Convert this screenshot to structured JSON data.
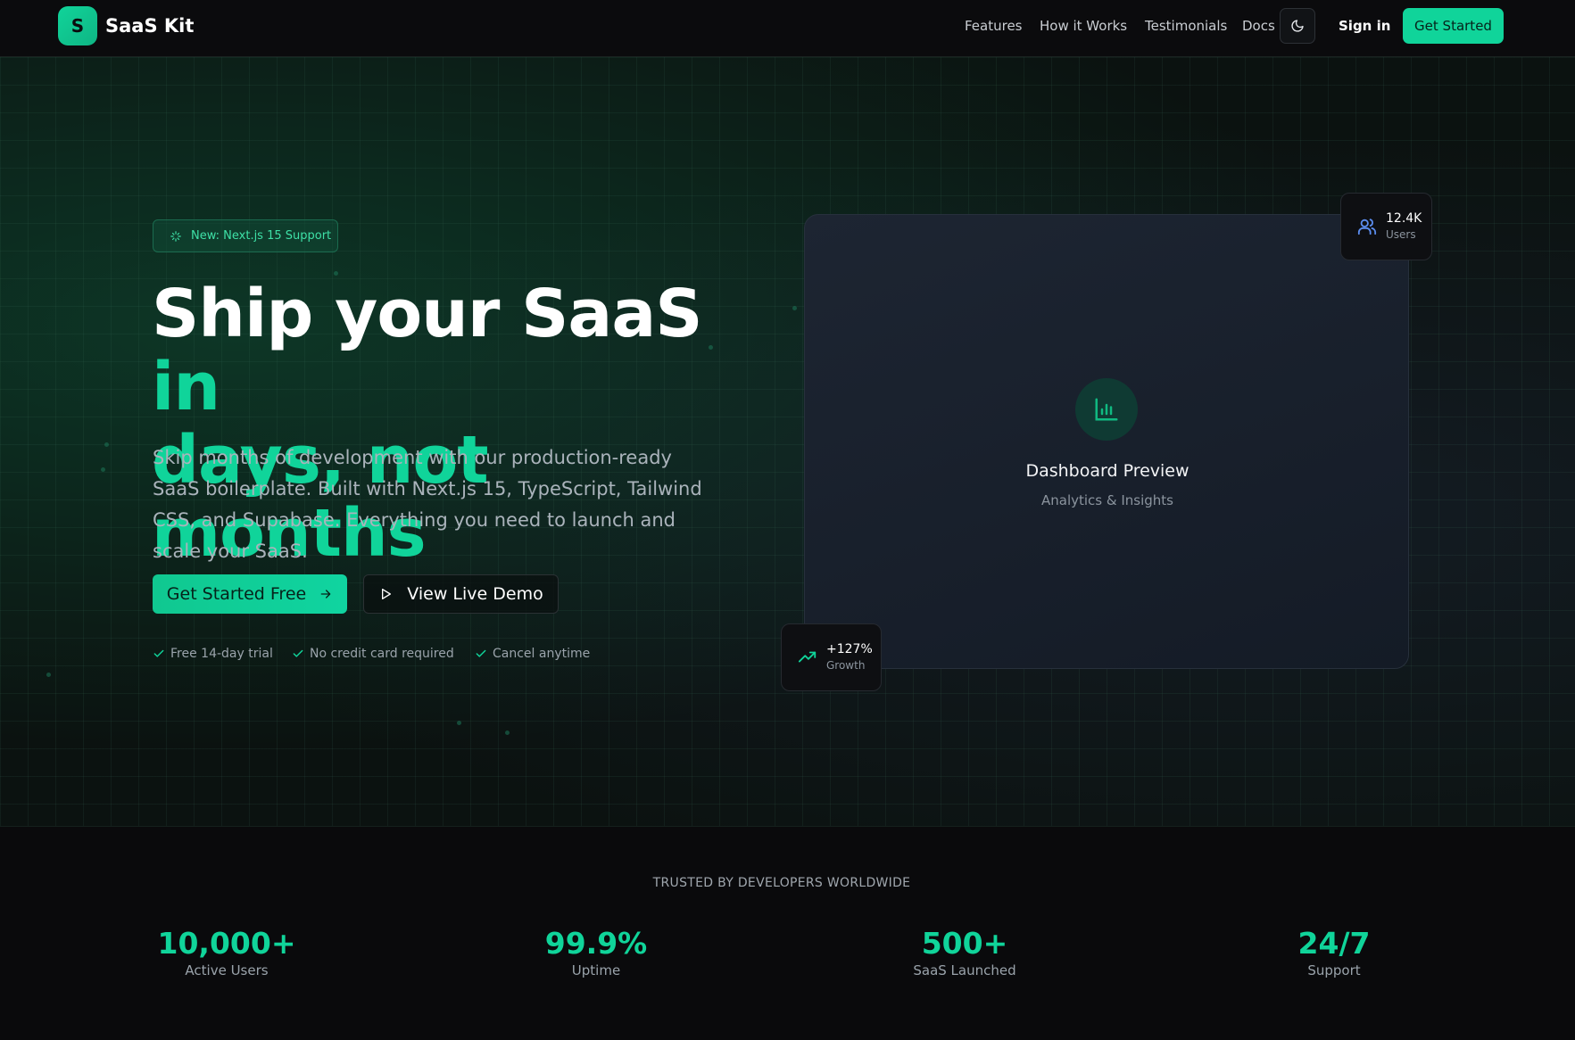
{
  "nav": {
    "logo_letter": "S",
    "brand": "SaaS Kit",
    "links": [
      "Features",
      "How it Works",
      "Testimonials",
      "Docs"
    ],
    "theme_icon": "moon-icon",
    "signin": "Sign in",
    "cta": "Get Started"
  },
  "hero": {
    "badge": "New: Next.js 15 Support",
    "badge_icon": "sparkle-icon",
    "headline_white": "Ship your SaaS",
    "headline_accent_1": "in",
    "headline_accent_2": "days, not months",
    "lead": "Skip months of development with our production-ready SaaS boilerplate. Built with Next.js 15, TypeScript, Tailwind CSS, and Supabase. Everything you need to launch and scale your SaaS.",
    "primary_cta": "Get Started Free",
    "secondary_cta": "View Live Demo",
    "perks": [
      "Free 14-day trial",
      "No credit card required",
      "Cancel anytime"
    ]
  },
  "preview": {
    "title": "Dashboard Preview",
    "subtitle": "Analytics & Insights",
    "icon": "bar-chart-icon",
    "users_value": "12.4K",
    "users_label": "Users",
    "growth_value": "+127%",
    "growth_label": "Growth"
  },
  "stats": {
    "label": "TRUSTED BY DEVELOPERS WORLDWIDE",
    "items": [
      {
        "value": "10,000+",
        "label": "Active Users"
      },
      {
        "value": "99.9%",
        "label": "Uptime"
      },
      {
        "value": "500+",
        "label": "SaaS Launched"
      },
      {
        "value": "24/7",
        "label": "Support"
      }
    ]
  },
  "colors": {
    "accent": "#10d49a",
    "background": "#0a0a0c",
    "users_icon": "#5b8def"
  }
}
